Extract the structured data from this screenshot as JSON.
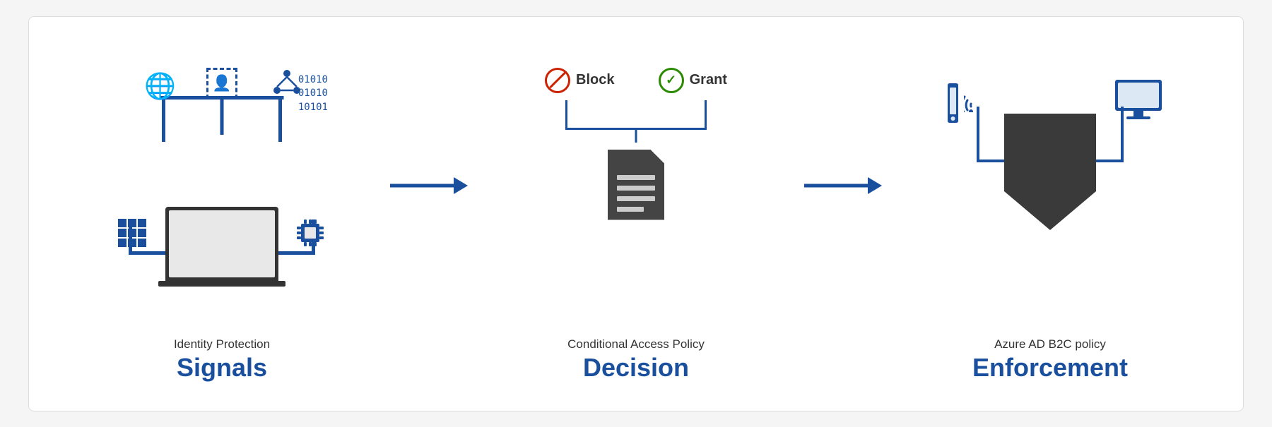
{
  "diagram": {
    "background_color": "#ffffff",
    "columns": [
      {
        "id": "signals",
        "sub_label": "Identity Protection",
        "main_label": "Signals",
        "label_color": "#1a4f9e"
      },
      {
        "id": "decision",
        "sub_label": "Conditional Access Policy",
        "main_label": "Decision",
        "label_color": "#1a4f9e"
      },
      {
        "id": "enforcement",
        "sub_label": "Azure AD B2C policy",
        "main_label": "Enforcement",
        "label_color": "#1a4f9e"
      }
    ],
    "decision_options": [
      {
        "id": "block",
        "label": "Block",
        "color": "#cc2200"
      },
      {
        "id": "grant",
        "label": "Grant",
        "color": "#2a8a00"
      }
    ],
    "arrow_color": "#1a4f9e",
    "binary_text": "01010\n01010\n10101"
  }
}
